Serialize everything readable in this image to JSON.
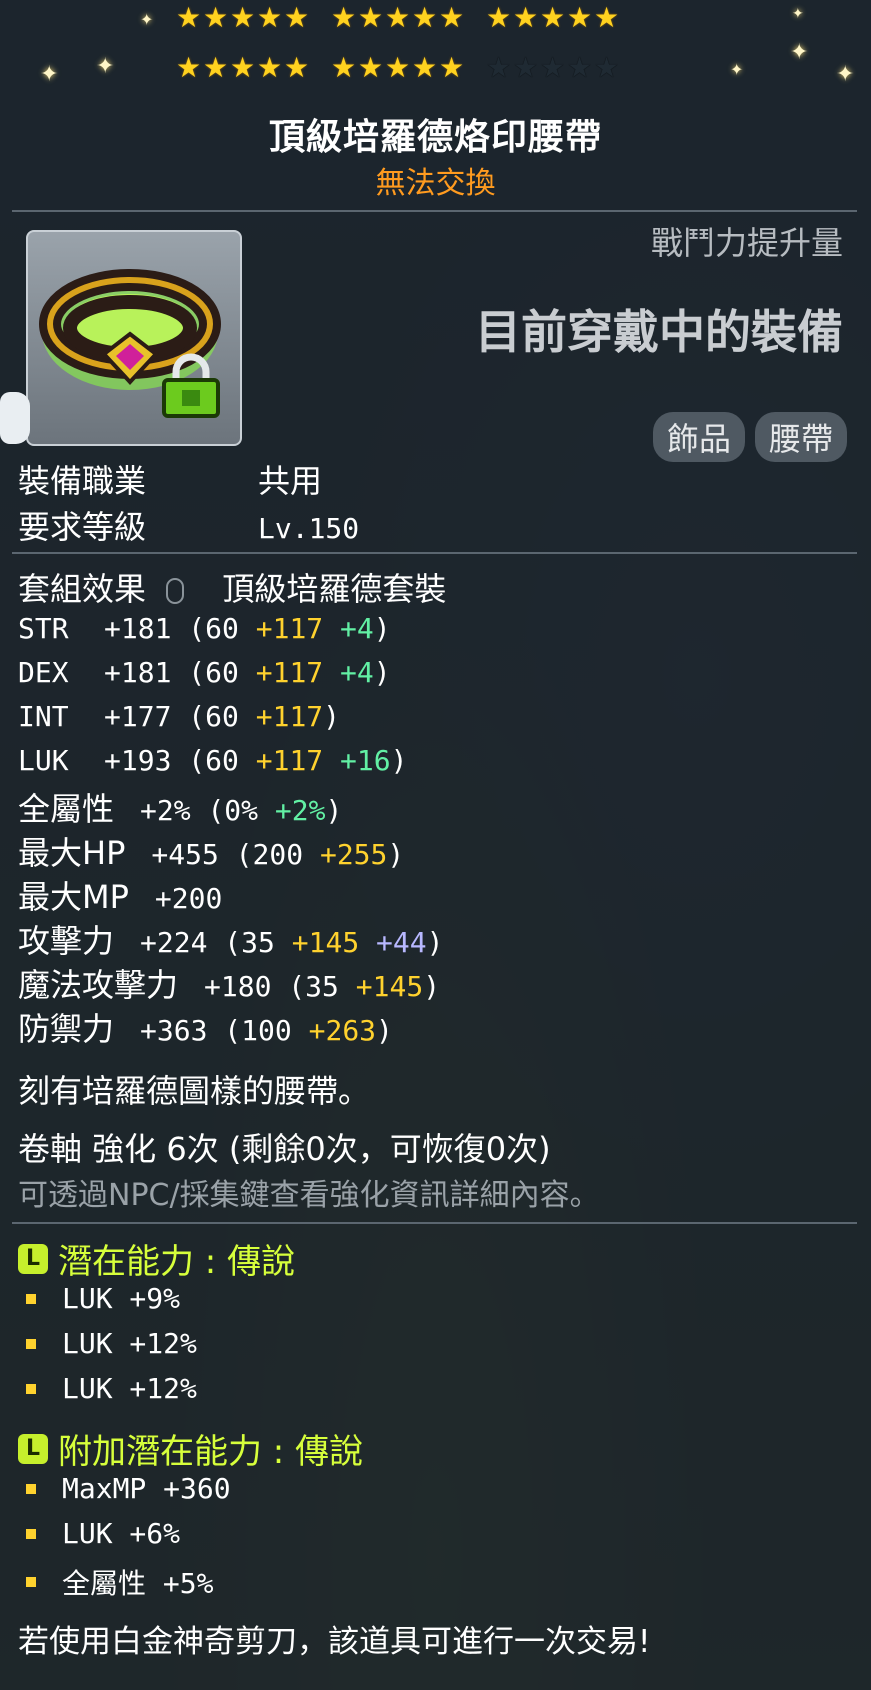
{
  "stars": {
    "filled": 25,
    "total": 30
  },
  "item": {
    "name": "頂級培羅德烙印腰帶",
    "trade_status": "無法交換"
  },
  "header": {
    "power_label": "戰鬥力提升量",
    "equipped_label": "目前穿戴中的裝備",
    "tags": [
      "飾品",
      "腰帶"
    ]
  },
  "requirements": [
    {
      "label": "裝備職業",
      "value": "共用"
    },
    {
      "label": "要求等級",
      "value": "Lv.150"
    }
  ],
  "set_effect": {
    "label": "套組效果",
    "value": "頂級培羅德套裝"
  },
  "stats": [
    {
      "name": "STR",
      "total": "+181",
      "open": " (60 ",
      "base_add": "+117",
      "extra": " +4",
      "extra_color": "green",
      "close": ")"
    },
    {
      "name": "DEX",
      "total": "+181",
      "open": " (60 ",
      "base_add": "+117",
      "extra": " +4",
      "extra_color": "green",
      "close": ")"
    },
    {
      "name": "INT",
      "total": "+177",
      "open": " (60 ",
      "base_add": "+117",
      "extra": "",
      "extra_color": "green",
      "close": ")"
    },
    {
      "name": "LUK",
      "total": "+193",
      "open": " (60 ",
      "base_add": "+117",
      "extra": " +16",
      "extra_color": "green",
      "close": ")"
    }
  ],
  "stats2": [
    {
      "name": "全屬性",
      "total": "+2%",
      "open": " (0% ",
      "base_add": "",
      "extra": "+2%",
      "extra_color": "green",
      "close": ")"
    },
    {
      "name": "最大HP",
      "total": "+455",
      "open": " (200 ",
      "base_add": "+255",
      "extra": "",
      "extra_color": "green",
      "close": ")"
    },
    {
      "name": "最大MP",
      "total": "+200",
      "open": "",
      "base_add": "",
      "extra": "",
      "extra_color": "green",
      "close": ""
    },
    {
      "name": "攻擊力",
      "total": "+224",
      "open": " (35 ",
      "base_add": "+145",
      "extra": " +44",
      "extra_color": "purple",
      "close": ")"
    },
    {
      "name": "魔法攻擊力",
      "total": "+180",
      "open": " (35 ",
      "base_add": "+145",
      "extra": "",
      "extra_color": "green",
      "close": ")"
    },
    {
      "name": "防禦力",
      "total": "+363",
      "open": " (100 ",
      "base_add": "+263",
      "extra": "",
      "extra_color": "green",
      "close": ")"
    }
  ],
  "description": "刻有培羅德圖樣的腰帶。",
  "upgrade": {
    "text": "卷軸 強化 6次 (剩餘0次，可恢復0次)",
    "hint": "可透過NPC/採集鍵查看強化資訊詳細內容。"
  },
  "potential": {
    "header": "潛在能力 : 傳說",
    "badge": "L",
    "lines": [
      "LUK +9%",
      "LUK +12%",
      "LUK +12%"
    ]
  },
  "bonus_potential": {
    "header": "附加潛在能力 : 傳說",
    "badge": "L",
    "lines": [
      "MaxMP +360",
      "LUK +6%",
      "全屬性 +5%"
    ]
  },
  "footer": "若使用白金神奇剪刀，該道具可進行一次交易!",
  "colors": {
    "trade": "#ff9b1f",
    "yellow": "#ffd22e",
    "green": "#62f0a4",
    "purple": "#b8b8ff",
    "potential": "#d7ff3b"
  }
}
